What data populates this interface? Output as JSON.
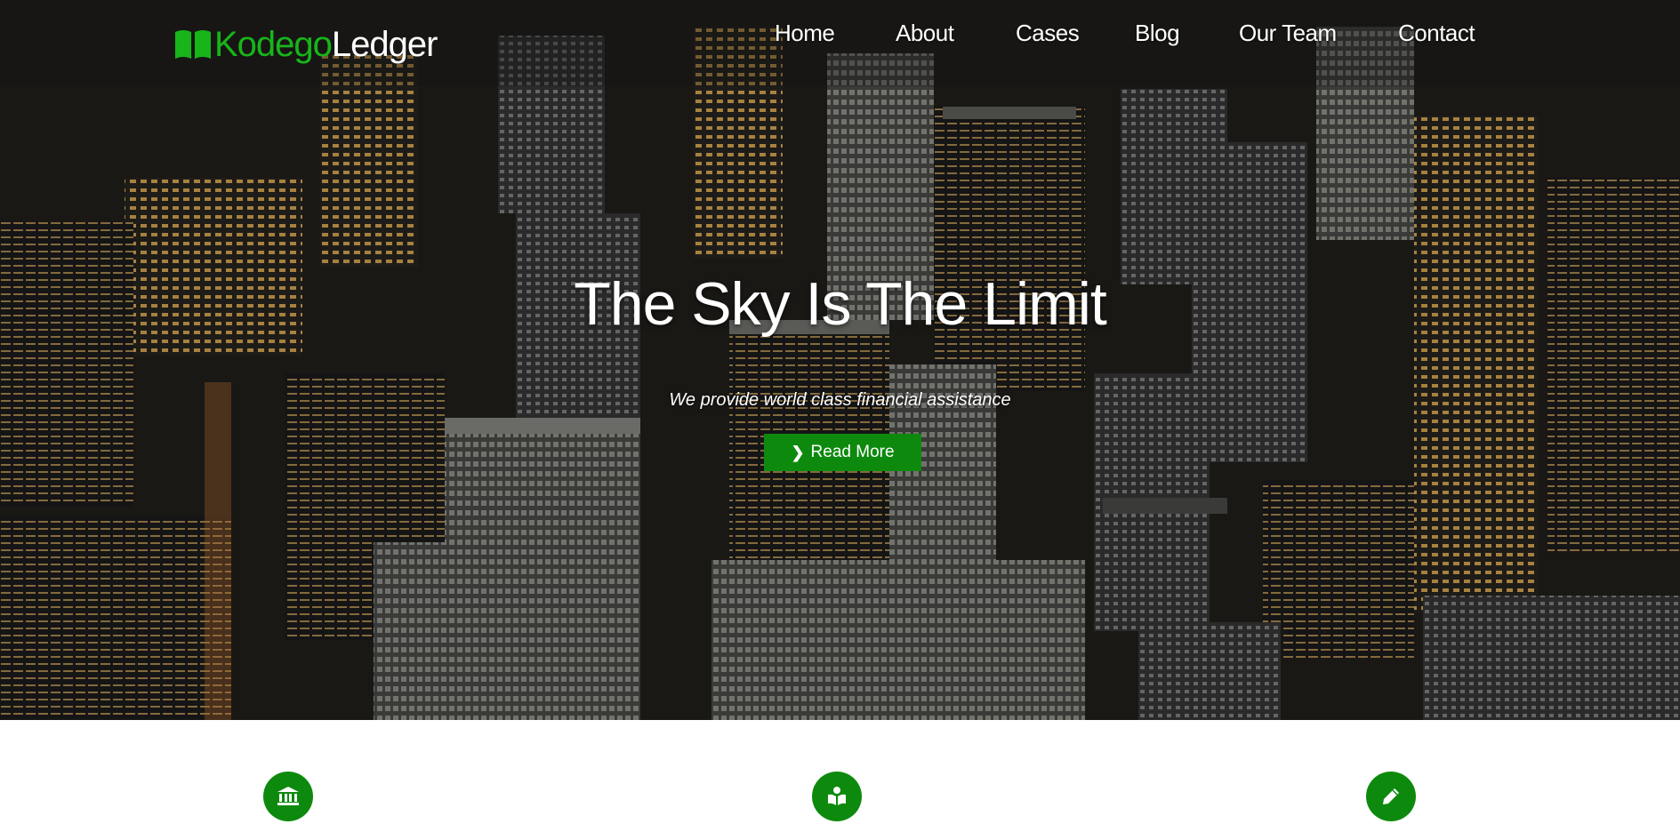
{
  "brand": {
    "name_part1": "Kodego",
    "name_part2": "Ledger",
    "icon": "open-book-icon",
    "accent_color": "#17b51a"
  },
  "nav": {
    "items": [
      {
        "label": "Home"
      },
      {
        "label": "About"
      },
      {
        "label": "Cases"
      },
      {
        "label": "Blog"
      },
      {
        "label": "Our Team"
      },
      {
        "label": "Contact"
      }
    ]
  },
  "hero": {
    "title": "The Sky Is The Limit",
    "subtitle": "We provide world class financial assistance",
    "button_label": "Read More",
    "button_icon": "chevron-right-icon",
    "button_color": "#0d8a0d"
  },
  "features": [
    {
      "icon": "bank-icon"
    },
    {
      "icon": "book-reader-icon"
    },
    {
      "icon": "pencil-icon"
    }
  ]
}
